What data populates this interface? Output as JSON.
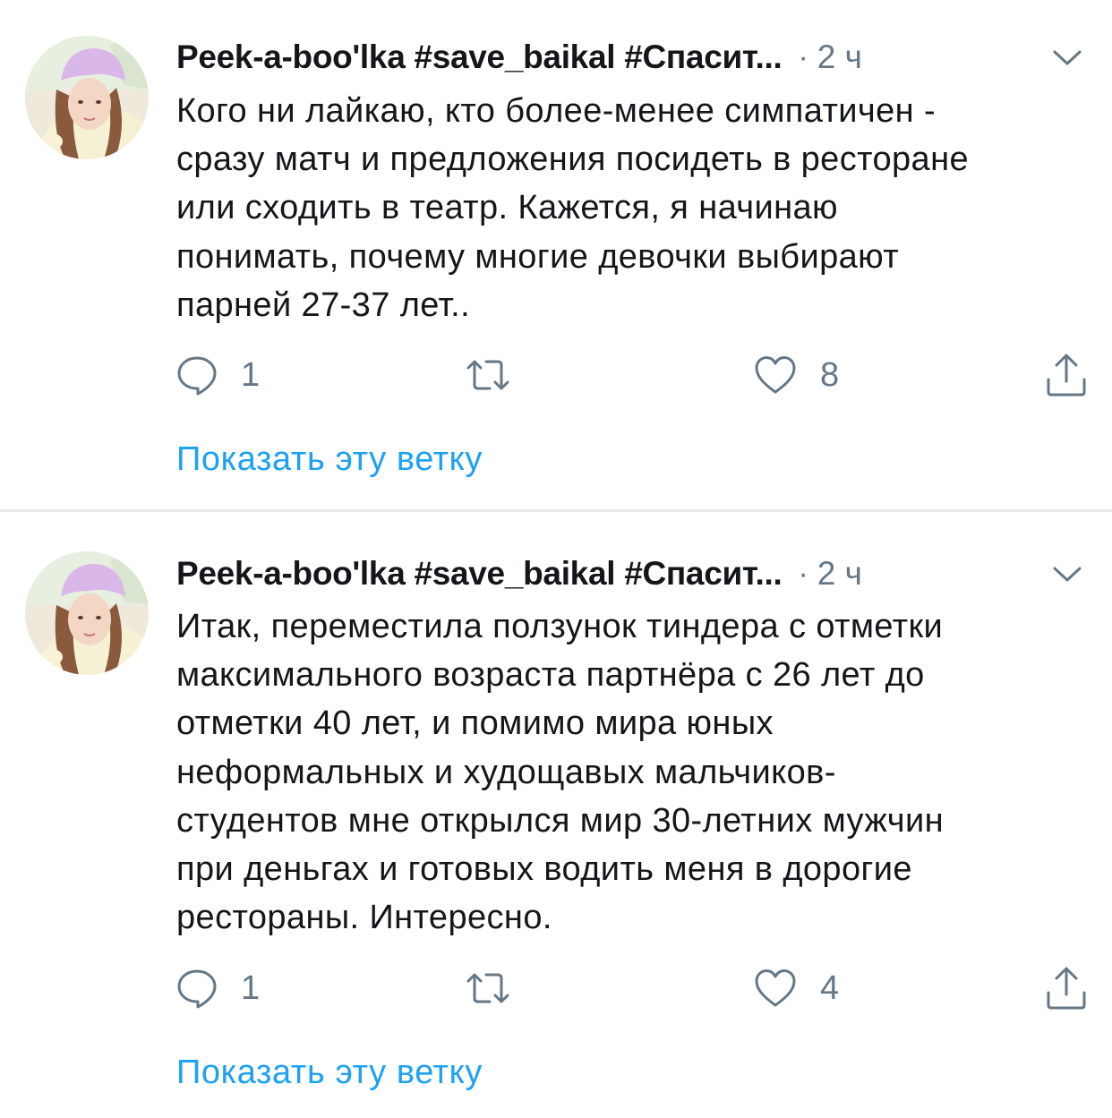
{
  "tweets": [
    {
      "author": "Peek-a-boo'lka #save_baikal #Спасит...",
      "separator": "·",
      "time": "2 ч",
      "text_lines": [
        "Кого ни лайкаю, кто более-менее симпатичен -",
        "сразу матч и предложения посидеть в ресторане",
        "или сходить в театр. Кажется, я начинаю",
        "понимать, почему многие девочки выбирают",
        "парней 27-37 лет.."
      ],
      "replies": "1",
      "likes": "8",
      "show_thread": "Показать эту ветку"
    },
    {
      "author": "Peek-a-boo'lka #save_baikal #Спасит...",
      "separator": "·",
      "time": "2 ч",
      "text_lines": [
        "Итак, переместила ползунок тиндера с отметки",
        "максимального возраста партнёра с 26 лет до",
        "отметки 40 лет, и помимо мира юных",
        "неформальных и худощавых мальчиков-",
        "студентов мне открылся мир 30-летних мужчин",
        "при деньгах и готовых водить меня в дорогие",
        "рестораны. Интересно."
      ],
      "replies": "1",
      "likes": "4",
      "show_thread": "Показать эту ветку"
    }
  ],
  "icons": {
    "reply": "speech-bubble-icon",
    "retweet": "retweet-arrows-icon",
    "like": "heart-outline-icon",
    "share": "share-upload-icon",
    "caret": "chevron-down-icon"
  },
  "colors": {
    "text": "#14171a",
    "secondary": "#657786",
    "link": "#1da1f2",
    "divider": "#e6ecf0"
  }
}
